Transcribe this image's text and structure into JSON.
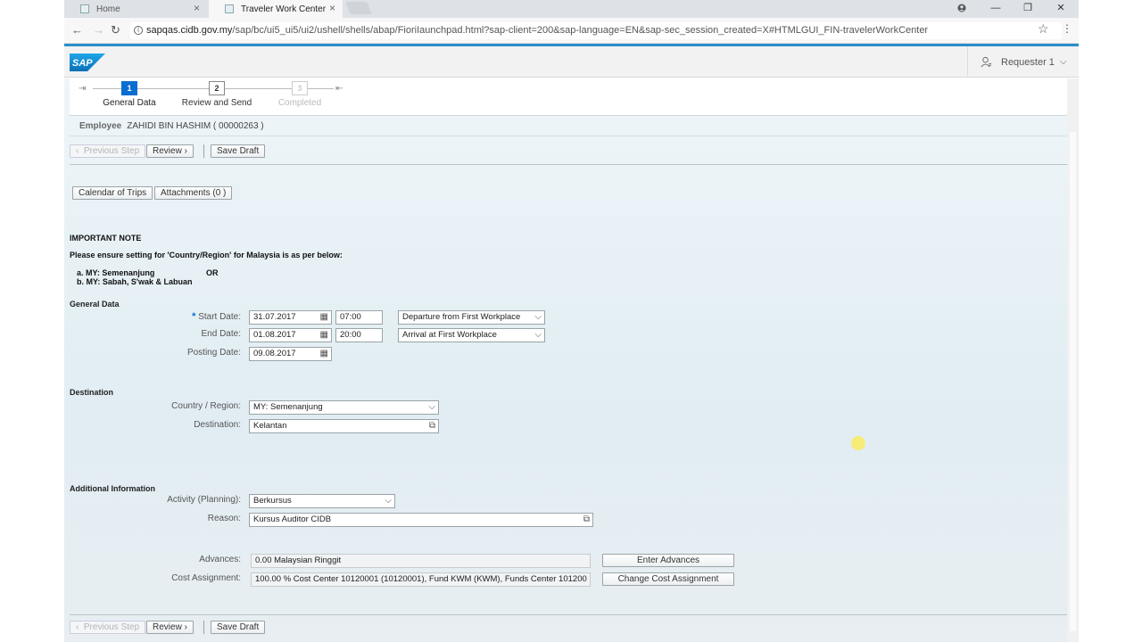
{
  "browser": {
    "tabs": [
      {
        "label": "Home",
        "active": false
      },
      {
        "label": "Traveler Work Center",
        "active": true
      }
    ],
    "url_host": "sapqas.cidb.gov.my",
    "url_path": "/sap/bc/ui5_ui5/ui2/ushell/shells/abap/FioriIaunchpad.html?sap-client=200&sap-language=EN&sap-sec_session_created=X#HTMLGUI_FIN-travelerWorkCenter",
    "window_controls": [
      "—",
      "❐",
      "✕"
    ]
  },
  "shell": {
    "logo_text": "SAP",
    "user_label": "Requester 1"
  },
  "wizard": {
    "steps": [
      {
        "number": "1",
        "label": "General Data",
        "state": "active"
      },
      {
        "number": "2",
        "label": "Review and Send",
        "state": "normal"
      },
      {
        "number": "3",
        "label": "Completed",
        "state": "disabled"
      }
    ]
  },
  "employee": {
    "label": "Employee",
    "value": "ZAHIDI BIN HASHIM ( 00000263 )"
  },
  "toolbar": {
    "previous_label": "Previous Step",
    "review_label": "Review",
    "save_draft_label": "Save Draft"
  },
  "actions": {
    "calendar_label": "Calendar of Trips",
    "attachments_label": "Attachments (0 )"
  },
  "note": {
    "title": "IMPORTANT NOTE",
    "line1": "Please ensure setting for 'Country/Region' for Malaysia is as per below:",
    "item_a": "a. MY: Semenanjung",
    "or": "OR",
    "item_b": "b. MY: Sabah, S'wak & Labuan"
  },
  "general_data": {
    "heading": "General Data",
    "start_date_label": "Start Date:",
    "start_date": "31.07.2017",
    "start_time": "07:00",
    "start_type": "Departure from First Workplace",
    "end_date_label": "End Date:",
    "end_date": "01.08.2017",
    "end_time": "20:00",
    "end_type": "Arrival at First Workplace",
    "posting_date_label": "Posting Date:",
    "posting_date": "09.08.2017"
  },
  "destination": {
    "heading": "Destination",
    "country_label": "Country / Region:",
    "country": "MY: Semenanjung",
    "destination_label": "Destination:",
    "destination": "Kelantan"
  },
  "additional": {
    "heading": "Additional Information",
    "activity_label": "Activity (Planning):",
    "activity": "Berkursus",
    "reason_label": "Reason:",
    "reason": "Kursus Auditor CIDB",
    "advances_label": "Advances:",
    "advances": "0.00 Malaysian Ringgit",
    "enter_advances_label": "Enter Advances",
    "cost_label": "Cost Assignment:",
    "cost": "100.00 % Cost Center 10120001 (10120001), Fund KWM (KWM), Funds Center 101200",
    "change_cost_label": "Change Cost Assignment"
  },
  "colors": {
    "accent": "#0a6ed1",
    "brand_strip": "#2a8fc9"
  }
}
